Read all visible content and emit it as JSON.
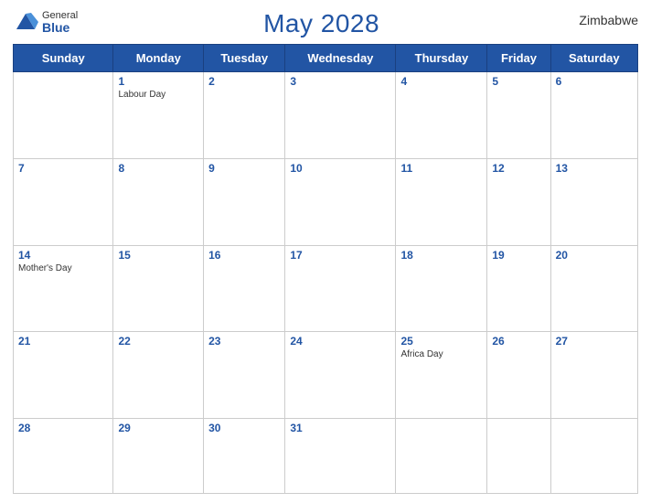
{
  "header": {
    "logo_general": "General",
    "logo_blue": "Blue",
    "title": "May 2028",
    "country": "Zimbabwe"
  },
  "days_of_week": [
    "Sunday",
    "Monday",
    "Tuesday",
    "Wednesday",
    "Thursday",
    "Friday",
    "Saturday"
  ],
  "weeks": [
    [
      {
        "day": "",
        "holiday": ""
      },
      {
        "day": "1",
        "holiday": "Labour Day"
      },
      {
        "day": "2",
        "holiday": ""
      },
      {
        "day": "3",
        "holiday": ""
      },
      {
        "day": "4",
        "holiday": ""
      },
      {
        "day": "5",
        "holiday": ""
      },
      {
        "day": "6",
        "holiday": ""
      }
    ],
    [
      {
        "day": "7",
        "holiday": ""
      },
      {
        "day": "8",
        "holiday": ""
      },
      {
        "day": "9",
        "holiday": ""
      },
      {
        "day": "10",
        "holiday": ""
      },
      {
        "day": "11",
        "holiday": ""
      },
      {
        "day": "12",
        "holiday": ""
      },
      {
        "day": "13",
        "holiday": ""
      }
    ],
    [
      {
        "day": "14",
        "holiday": "Mother's Day"
      },
      {
        "day": "15",
        "holiday": ""
      },
      {
        "day": "16",
        "holiday": ""
      },
      {
        "day": "17",
        "holiday": ""
      },
      {
        "day": "18",
        "holiday": ""
      },
      {
        "day": "19",
        "holiday": ""
      },
      {
        "day": "20",
        "holiday": ""
      }
    ],
    [
      {
        "day": "21",
        "holiday": ""
      },
      {
        "day": "22",
        "holiday": ""
      },
      {
        "day": "23",
        "holiday": ""
      },
      {
        "day": "24",
        "holiday": ""
      },
      {
        "day": "25",
        "holiday": "Africa Day"
      },
      {
        "day": "26",
        "holiday": ""
      },
      {
        "day": "27",
        "holiday": ""
      }
    ],
    [
      {
        "day": "28",
        "holiday": ""
      },
      {
        "day": "29",
        "holiday": ""
      },
      {
        "day": "30",
        "holiday": ""
      },
      {
        "day": "31",
        "holiday": ""
      },
      {
        "day": "",
        "holiday": ""
      },
      {
        "day": "",
        "holiday": ""
      },
      {
        "day": "",
        "holiday": ""
      }
    ]
  ]
}
